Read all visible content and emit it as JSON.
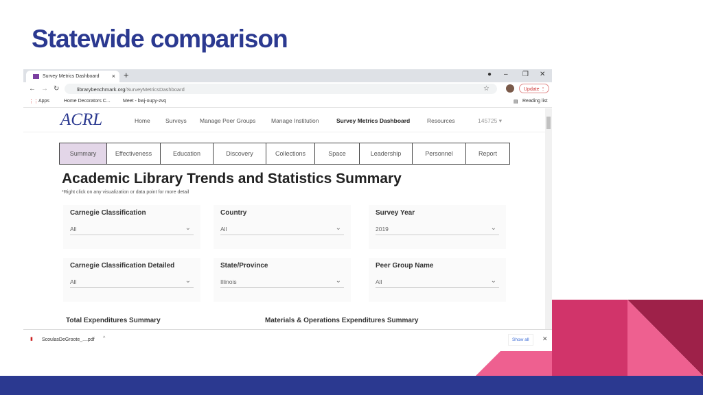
{
  "slide": {
    "title": "Statewide comparison"
  },
  "browser": {
    "tab_title": "Survey Metrics Dashboard",
    "url_domain": "librarybenchmark.org",
    "url_path": "/SurveyMetricsDashboard",
    "update_label": "Update",
    "reading_list": "Reading list",
    "bookmarks": [
      "Apps",
      "Home Decorators C...",
      "Meet - bwj-oupy-zvq"
    ]
  },
  "site": {
    "logo": "ACRL",
    "nav": [
      "Home",
      "Surveys",
      "Manage Peer Groups",
      "Manage Institution",
      "Survey Metrics Dashboard",
      "Resources"
    ],
    "user": "145725 ▾",
    "tabs": [
      "Summary",
      "Effectiveness",
      "Education",
      "Discovery",
      "Collections",
      "Space",
      "Leadership",
      "Personnel",
      "Report"
    ],
    "heading": "Academic Library Trends and Statistics Summary",
    "note": "*Right click on any visualization or data point for more detail",
    "filters": [
      {
        "label": "Carnegie Classification",
        "value": "All"
      },
      {
        "label": "Country",
        "value": "All"
      },
      {
        "label": "Survey Year",
        "value": "2019"
      },
      {
        "label": "Carnegie Classification Detailed",
        "value": "All"
      },
      {
        "label": "State/Province",
        "value": "Illinois"
      },
      {
        "label": "Peer Group Name",
        "value": "All"
      }
    ],
    "sections": [
      "Total Expenditures Summary",
      "Materials & Operations Expenditures Summary"
    ]
  },
  "downloads": {
    "file": "ScoulasDeGroote_....pdf",
    "show_all": "Show all"
  },
  "colors": {
    "title": "#2b3990",
    "bar": "#2b3990",
    "pink": "#ee6090",
    "rose": "#d1346a",
    "maroon": "#9e2149",
    "active_tab": "#e3d6e8"
  }
}
